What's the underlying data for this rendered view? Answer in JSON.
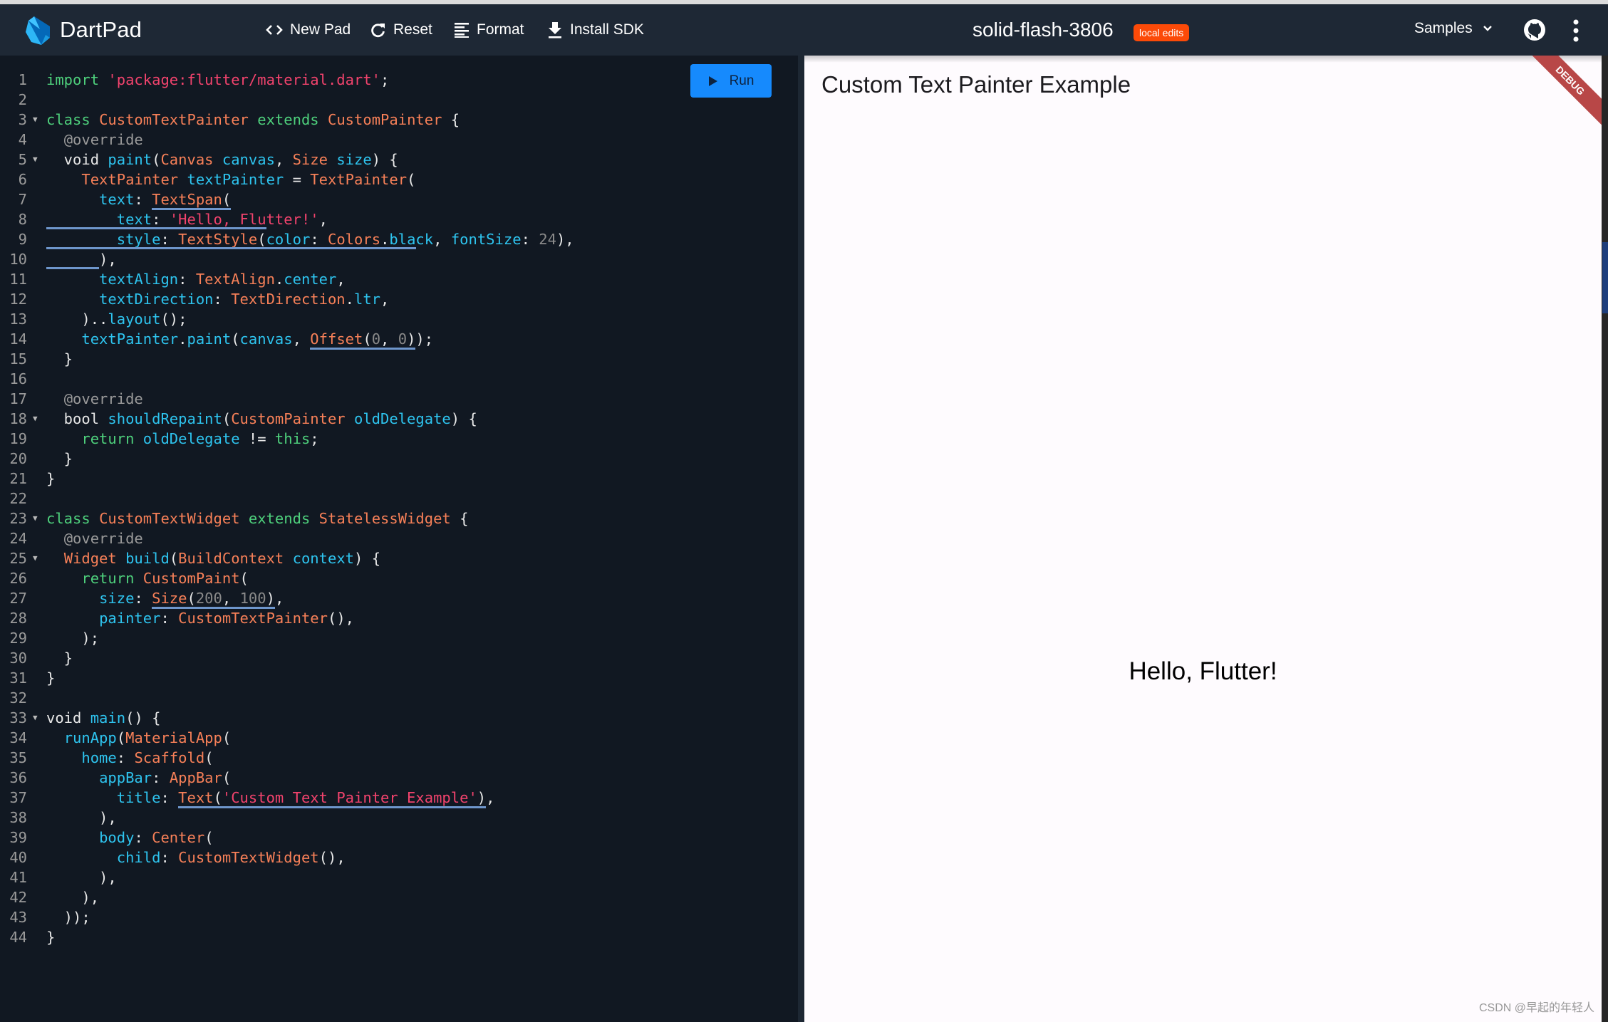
{
  "header": {
    "brand": "DartPad",
    "toolbar": [
      {
        "icon": "code-brackets-icon",
        "label": "New Pad"
      },
      {
        "icon": "refresh-icon",
        "label": "Reset"
      },
      {
        "icon": "format-align-icon",
        "label": "Format"
      },
      {
        "icon": "download-icon",
        "label": "Install SDK"
      }
    ],
    "pad_title": "solid-flash-3806",
    "badge": "local edits",
    "badge_color": "#fc4a08",
    "samples_label": "Samples"
  },
  "editor": {
    "run_label": "Run",
    "run_color": "#168afd",
    "lines": [
      {
        "n": "1",
        "fold": false
      },
      {
        "n": "2",
        "fold": false
      },
      {
        "n": "3",
        "fold": true
      },
      {
        "n": "4",
        "fold": false
      },
      {
        "n": "5",
        "fold": true
      },
      {
        "n": "6",
        "fold": false
      },
      {
        "n": "7",
        "fold": false
      },
      {
        "n": "8",
        "fold": false
      },
      {
        "n": "9",
        "fold": false
      },
      {
        "n": "10",
        "fold": false
      },
      {
        "n": "11",
        "fold": false
      },
      {
        "n": "12",
        "fold": false
      },
      {
        "n": "13",
        "fold": false
      },
      {
        "n": "14",
        "fold": false
      },
      {
        "n": "15",
        "fold": false
      },
      {
        "n": "16",
        "fold": false
      },
      {
        "n": "17",
        "fold": false
      },
      {
        "n": "18",
        "fold": true
      },
      {
        "n": "19",
        "fold": false
      },
      {
        "n": "20",
        "fold": false
      },
      {
        "n": "21",
        "fold": false
      },
      {
        "n": "22",
        "fold": false
      },
      {
        "n": "23",
        "fold": true
      },
      {
        "n": "24",
        "fold": false
      },
      {
        "n": "25",
        "fold": true
      },
      {
        "n": "26",
        "fold": false
      },
      {
        "n": "27",
        "fold": false
      },
      {
        "n": "28",
        "fold": false
      },
      {
        "n": "29",
        "fold": false
      },
      {
        "n": "30",
        "fold": false
      },
      {
        "n": "31",
        "fold": false
      },
      {
        "n": "32",
        "fold": false
      },
      {
        "n": "33",
        "fold": true
      },
      {
        "n": "34",
        "fold": false
      },
      {
        "n": "35",
        "fold": false
      },
      {
        "n": "36",
        "fold": false
      },
      {
        "n": "37",
        "fold": false
      },
      {
        "n": "38",
        "fold": false
      },
      {
        "n": "39",
        "fold": false
      },
      {
        "n": "40",
        "fold": false
      },
      {
        "n": "41",
        "fold": false
      },
      {
        "n": "42",
        "fold": false
      },
      {
        "n": "43",
        "fold": false
      },
      {
        "n": "44",
        "fold": false
      }
    ],
    "code": [
      [
        [
          "kw",
          "import"
        ],
        [
          "pl",
          " "
        ],
        [
          "str",
          "'package:flutter/material.dart'"
        ],
        [
          "pl",
          ";"
        ]
      ],
      [],
      [
        [
          "kw",
          "class"
        ],
        [
          "pl",
          " "
        ],
        [
          "ty",
          "CustomTextPainter"
        ],
        [
          "pl",
          " "
        ],
        [
          "kw",
          "extends"
        ],
        [
          "pl",
          " "
        ],
        [
          "ty",
          "CustomPainter"
        ],
        [
          "pl",
          " {"
        ]
      ],
      [
        [
          "pl",
          "  "
        ],
        [
          "an",
          "@override"
        ]
      ],
      [
        [
          "pl",
          "  void "
        ],
        [
          "id",
          "paint"
        ],
        [
          "pl",
          "("
        ],
        [
          "ty",
          "Canvas"
        ],
        [
          "pl",
          " "
        ],
        [
          "id",
          "canvas"
        ],
        [
          "pl",
          ", "
        ],
        [
          "ty",
          "Size"
        ],
        [
          "pl",
          " "
        ],
        [
          "id",
          "size"
        ],
        [
          "pl",
          ") {"
        ]
      ],
      [
        [
          "pl",
          "    "
        ],
        [
          "ty",
          "TextPainter"
        ],
        [
          "pl",
          " "
        ],
        [
          "id",
          "textPainter"
        ],
        [
          "pl",
          " = "
        ],
        [
          "ty",
          "TextPainter"
        ],
        [
          "pl",
          "("
        ]
      ],
      [
        [
          "pl",
          "      "
        ],
        [
          "id",
          "text"
        ],
        [
          "pl",
          ": "
        ],
        [
          "ty",
          "TextSpan",
          "ul"
        ],
        [
          "pl",
          "(",
          "ul"
        ]
      ],
      [
        [
          "pl",
          "        "
        ],
        [
          "id",
          "text"
        ],
        [
          "pl",
          ": "
        ],
        [
          "str",
          "'Hello, Flutter!'"
        ],
        [
          "pl",
          ","
        ]
      ],
      [
        [
          "pl",
          "        "
        ],
        [
          "id",
          "style"
        ],
        [
          "pl",
          ": "
        ],
        [
          "ty",
          "TextStyle"
        ],
        [
          "pl",
          "("
        ],
        [
          "id",
          "color"
        ],
        [
          "pl",
          ": "
        ],
        [
          "ty",
          "Colors"
        ],
        [
          "pl",
          "."
        ],
        [
          "id",
          "black"
        ],
        [
          "pl",
          ", "
        ],
        [
          "id",
          "fontSize"
        ],
        [
          "pl",
          ": "
        ],
        [
          "num",
          "24"
        ],
        [
          "pl",
          "),"
        ]
      ],
      [
        [
          "pl",
          "      ),"
        ]
      ],
      [
        [
          "pl",
          "      "
        ],
        [
          "id",
          "textAlign"
        ],
        [
          "pl",
          ": "
        ],
        [
          "ty",
          "TextAlign"
        ],
        [
          "pl",
          "."
        ],
        [
          "id",
          "center"
        ],
        [
          "pl",
          ","
        ]
      ],
      [
        [
          "pl",
          "      "
        ],
        [
          "id",
          "textDirection"
        ],
        [
          "pl",
          ": "
        ],
        [
          "ty",
          "TextDirection"
        ],
        [
          "pl",
          "."
        ],
        [
          "id",
          "ltr"
        ],
        [
          "pl",
          ","
        ]
      ],
      [
        [
          "pl",
          "    ).."
        ],
        [
          "id",
          "layout"
        ],
        [
          "pl",
          "();"
        ]
      ],
      [
        [
          "pl",
          "    "
        ],
        [
          "id",
          "textPainter"
        ],
        [
          "pl",
          "."
        ],
        [
          "id",
          "paint"
        ],
        [
          "pl",
          "("
        ],
        [
          "id",
          "canvas"
        ],
        [
          "pl",
          ", "
        ],
        [
          "ty",
          "Offset",
          "ul"
        ],
        [
          "pl",
          "(",
          "ul"
        ],
        [
          "num",
          "0",
          "ul"
        ],
        [
          "pl",
          ", ",
          "ul"
        ],
        [
          "num",
          "0",
          "ul"
        ],
        [
          "pl",
          ")",
          "ul"
        ],
        [
          "pl",
          ");"
        ]
      ],
      [
        [
          "pl",
          "  }"
        ]
      ],
      [],
      [
        [
          "pl",
          "  "
        ],
        [
          "an",
          "@override"
        ]
      ],
      [
        [
          "pl",
          "  bool "
        ],
        [
          "id",
          "shouldRepaint"
        ],
        [
          "pl",
          "("
        ],
        [
          "ty",
          "CustomPainter"
        ],
        [
          "pl",
          " "
        ],
        [
          "id",
          "oldDelegate"
        ],
        [
          "pl",
          ") {"
        ]
      ],
      [
        [
          "pl",
          "    "
        ],
        [
          "kw",
          "return"
        ],
        [
          "pl",
          " "
        ],
        [
          "id",
          "oldDelegate"
        ],
        [
          "pl",
          " != "
        ],
        [
          "kw",
          "this"
        ],
        [
          "pl",
          ";"
        ]
      ],
      [
        [
          "pl",
          "  }"
        ]
      ],
      [
        [
          "pl",
          "}"
        ]
      ],
      [],
      [
        [
          "kw",
          "class"
        ],
        [
          "pl",
          " "
        ],
        [
          "ty",
          "CustomTextWidget"
        ],
        [
          "pl",
          " "
        ],
        [
          "kw",
          "extends"
        ],
        [
          "pl",
          " "
        ],
        [
          "ty",
          "StatelessWidget"
        ],
        [
          "pl",
          " {"
        ]
      ],
      [
        [
          "pl",
          "  "
        ],
        [
          "an",
          "@override"
        ]
      ],
      [
        [
          "pl",
          "  "
        ],
        [
          "ty",
          "Widget"
        ],
        [
          "pl",
          " "
        ],
        [
          "id",
          "build"
        ],
        [
          "pl",
          "("
        ],
        [
          "ty",
          "BuildContext"
        ],
        [
          "pl",
          " "
        ],
        [
          "id",
          "context"
        ],
        [
          "pl",
          ") {"
        ]
      ],
      [
        [
          "pl",
          "    "
        ],
        [
          "kw",
          "return"
        ],
        [
          "pl",
          " "
        ],
        [
          "ty",
          "CustomPaint"
        ],
        [
          "pl",
          "("
        ]
      ],
      [
        [
          "pl",
          "      "
        ],
        [
          "id",
          "size"
        ],
        [
          "pl",
          ": "
        ],
        [
          "ty",
          "Size",
          "ul"
        ],
        [
          "pl",
          "(",
          "ul"
        ],
        [
          "num",
          "200",
          "ul"
        ],
        [
          "pl",
          ", ",
          "ul"
        ],
        [
          "num",
          "100",
          "ul"
        ],
        [
          "pl",
          ")",
          "ul"
        ],
        [
          "pl",
          ","
        ]
      ],
      [
        [
          "pl",
          "      "
        ],
        [
          "id",
          "painter"
        ],
        [
          "pl",
          ": "
        ],
        [
          "ty",
          "CustomTextPainter"
        ],
        [
          "pl",
          "(),"
        ]
      ],
      [
        [
          "pl",
          "    );"
        ]
      ],
      [
        [
          "pl",
          "  }"
        ]
      ],
      [
        [
          "pl",
          "}"
        ]
      ],
      [],
      [
        [
          "pl",
          "void "
        ],
        [
          "id",
          "main"
        ],
        [
          "pl",
          "() {"
        ]
      ],
      [
        [
          "pl",
          "  "
        ],
        [
          "id",
          "runApp"
        ],
        [
          "pl",
          "("
        ],
        [
          "ty",
          "MaterialApp"
        ],
        [
          "pl",
          "("
        ]
      ],
      [
        [
          "pl",
          "    "
        ],
        [
          "id",
          "home"
        ],
        [
          "pl",
          ": "
        ],
        [
          "ty",
          "Scaffold"
        ],
        [
          "pl",
          "("
        ]
      ],
      [
        [
          "pl",
          "      "
        ],
        [
          "id",
          "appBar"
        ],
        [
          "pl",
          ": "
        ],
        [
          "ty",
          "AppBar"
        ],
        [
          "pl",
          "("
        ]
      ],
      [
        [
          "pl",
          "        "
        ],
        [
          "id",
          "title"
        ],
        [
          "pl",
          ": "
        ],
        [
          "ty",
          "Text",
          "ul"
        ],
        [
          "pl",
          "(",
          "ul"
        ],
        [
          "str",
          "'Custom Text Painter Example'",
          "ul"
        ],
        [
          "pl",
          ")",
          "ul"
        ],
        [
          "pl",
          ","
        ]
      ],
      [
        [
          "pl",
          "      ),"
        ]
      ],
      [
        [
          "pl",
          "      "
        ],
        [
          "id",
          "body"
        ],
        [
          "pl",
          ": "
        ],
        [
          "ty",
          "Center"
        ],
        [
          "pl",
          "("
        ]
      ],
      [
        [
          "pl",
          "        "
        ],
        [
          "id",
          "child"
        ],
        [
          "pl",
          ": "
        ],
        [
          "ty",
          "CustomTextWidget"
        ],
        [
          "pl",
          "(),"
        ]
      ],
      [
        [
          "pl",
          "      ),"
        ]
      ],
      [
        [
          "pl",
          "    ),"
        ]
      ],
      [
        [
          "pl",
          "  ));"
        ]
      ],
      [
        [
          "pl",
          "}"
        ]
      ]
    ]
  },
  "preview": {
    "app_title": "Custom Text Painter Example",
    "body_text": "Hello, Flutter!",
    "debug_banner": "DEBUG"
  },
  "watermark": "CSDN @早起的年轻人"
}
